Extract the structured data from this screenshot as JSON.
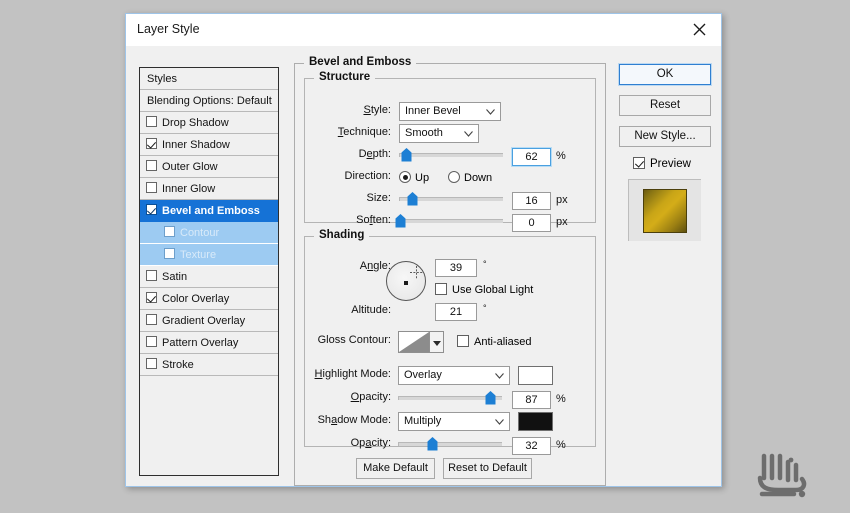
{
  "window": {
    "title": "Layer Style",
    "close_icon": "close-icon"
  },
  "styles_panel": {
    "header": "Styles",
    "blending_options": "Blending Options: Default",
    "items": [
      {
        "label": "Drop Shadow",
        "checked": false,
        "selected": false,
        "sub": false
      },
      {
        "label": "Inner Shadow",
        "checked": true,
        "selected": false,
        "sub": false
      },
      {
        "label": "Outer Glow",
        "checked": false,
        "selected": false,
        "sub": false
      },
      {
        "label": "Inner Glow",
        "checked": false,
        "selected": false,
        "sub": false
      },
      {
        "label": "Bevel and Emboss",
        "checked": true,
        "selected": true,
        "sub": false
      },
      {
        "label": "Contour",
        "checked": false,
        "selected": false,
        "sub": true
      },
      {
        "label": "Texture",
        "checked": false,
        "selected": false,
        "sub": true
      },
      {
        "label": "Satin",
        "checked": false,
        "selected": false,
        "sub": false
      },
      {
        "label": "Color Overlay",
        "checked": true,
        "selected": false,
        "sub": false
      },
      {
        "label": "Gradient Overlay",
        "checked": false,
        "selected": false,
        "sub": false
      },
      {
        "label": "Pattern Overlay",
        "checked": false,
        "selected": false,
        "sub": false
      },
      {
        "label": "Stroke",
        "checked": false,
        "selected": false,
        "sub": false
      }
    ]
  },
  "main": {
    "group_title": "Bevel and Emboss",
    "structure": {
      "title": "Structure",
      "style_label": "Style:",
      "style_value": "Inner Bevel",
      "technique_label": "Technique:",
      "technique_value": "Smooth",
      "depth_label": "Depth:",
      "depth_value": "62",
      "depth_unit": "%",
      "depth_percent": 62,
      "direction_label": "Direction:",
      "direction_up": "Up",
      "direction_down": "Down",
      "direction_selected": "Up",
      "size_label": "Size:",
      "size_value": "16",
      "size_unit": "px",
      "size_percent": 8,
      "soften_label": "Soften:",
      "soften_value": "0",
      "soften_unit": "px",
      "soften_percent": 0
    },
    "shading": {
      "title": "Shading",
      "angle_label": "Angle:",
      "angle_value": "39",
      "angle_unit": "°",
      "use_global_light_label": "Use Global Light",
      "use_global_light_checked": false,
      "altitude_label": "Altitude:",
      "altitude_value": "21",
      "altitude_unit": "°",
      "gloss_contour_label": "Gloss Contour:",
      "anti_aliased_label": "Anti-aliased",
      "anti_aliased_checked": false,
      "highlight_mode_label": "Highlight Mode:",
      "highlight_mode_value": "Overlay",
      "highlight_color": "#ffffff",
      "highlight_opacity_label": "Opacity:",
      "highlight_opacity_value": "87",
      "highlight_opacity_unit": "%",
      "highlight_opacity_percent": 87,
      "shadow_mode_label": "Shadow Mode:",
      "shadow_mode_value": "Multiply",
      "shadow_color": "#111111",
      "shadow_opacity_label": "Opacity:",
      "shadow_opacity_value": "32",
      "shadow_opacity_unit": "%",
      "shadow_opacity_percent": 32
    },
    "make_default": "Make Default",
    "reset_to_default": "Reset to Default"
  },
  "right_column": {
    "ok": "OK",
    "reset": "Reset",
    "new_style": "New Style...",
    "preview_label": "Preview",
    "preview_checked": true
  },
  "colors": {
    "selection_blue": "#1572d6",
    "sub_selection_blue": "#9dcbf2",
    "slider_thumb_blue": "#1d7fd4",
    "dialog_bg": "#f0f0f0",
    "desktop_bg": "#c2c2c2",
    "preview_gold": "#c9a517"
  }
}
